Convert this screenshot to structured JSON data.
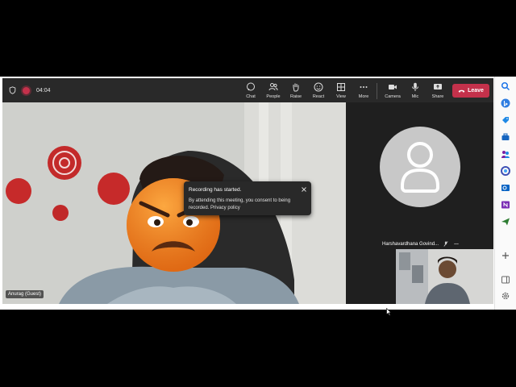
{
  "meeting": {
    "timer": "04:04"
  },
  "toolbar": {
    "chat": "Chat",
    "people": "People",
    "raise": "Raise",
    "react": "React",
    "view": "View",
    "more": "More",
    "camera": "Camera",
    "mic": "Mic",
    "share": "Share",
    "leave": "Leave"
  },
  "main_video": {
    "label": "Anurag (Guest)"
  },
  "toast": {
    "title": "Recording has started.",
    "body": "By attending this meeting, you consent to being recorded. Privacy policy"
  },
  "participant": {
    "name": "Harshavardhana Govind..."
  },
  "colors": {
    "leave": "#c4314b",
    "toolbar": "#292929",
    "stage": "#1f1f1f"
  },
  "sidebar_icons": [
    "search-icon",
    "bing-icon",
    "edge-shopping-icon",
    "tools-icon",
    "people-icon",
    "copilot-icon",
    "outlook-icon",
    "onenote-icon",
    "send-icon",
    "add-icon",
    "layout-icon",
    "settings-icon"
  ]
}
